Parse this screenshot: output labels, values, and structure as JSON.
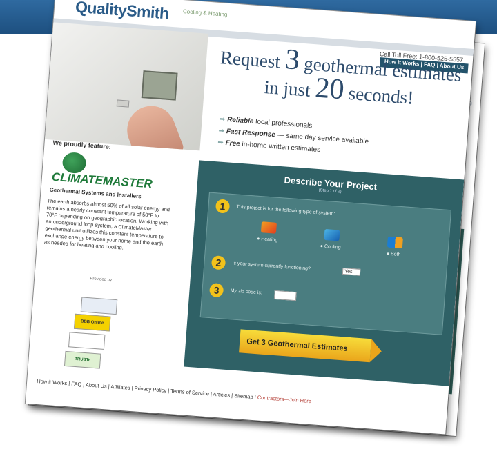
{
  "brand": {
    "name": "QualitySmith",
    "tagline": "Cooling & Heating"
  },
  "header": {
    "phone": "Call Toll Free: 1-800-525-5557",
    "nav": "How it Works | FAQ | About Us"
  },
  "hero": {
    "line1": "Request",
    "line1_num": "3",
    "line1_end": "geothermal estimates",
    "line2": "in just",
    "line2_num": "20",
    "line2_end": "seconds!"
  },
  "bullets": [
    {
      "bold": "Reliable",
      "rest": "local professionals"
    },
    {
      "bold": "Fast Response",
      "rest": "— same day service available"
    },
    {
      "bold": "Free",
      "rest": "in-home written estimates"
    }
  ],
  "sidebar": {
    "feature_title": "We proudly feature:",
    "partner_logo": "CLIMATEMASTER",
    "partner_sub": "Geothermal Systems and Installers",
    "partner_text": "The earth absorbs almost 50% of all solar energy and remains a nearly constant temperature of 50°F to 70°F depending on geographic location. Working with an underground loop system, a ClimateMaster geothermal unit utilizes this constant temperature to exchange energy between your home and the earth as needed for heating and cooling.",
    "provided_by": "Provided by",
    "badges": [
      "",
      "BBB Online",
      "",
      "TRUSTe"
    ]
  },
  "form": {
    "title": "Describe Your Project",
    "subtitle": "(Step 1 of 2)",
    "q1": "This project is for the following type of system:",
    "options": [
      "Heating",
      "Cooling",
      "Both"
    ],
    "q2": "Is your system currently functioning?",
    "q2_value": "Yes",
    "q3": "My zip code is:",
    "cta": "Get 3 Geothermal Estimates"
  },
  "footer": {
    "links": [
      "How it Works",
      "FAQ",
      "About Us",
      "Affiliates",
      "Privacy Policy",
      "Terms of Service",
      "Articles",
      "Sitemap"
    ],
    "contractor": "Contractors—Join Here"
  },
  "colors": {
    "accent": "#2f6166",
    "cta": "#f2c21b",
    "brand": "#2a5b88"
  }
}
